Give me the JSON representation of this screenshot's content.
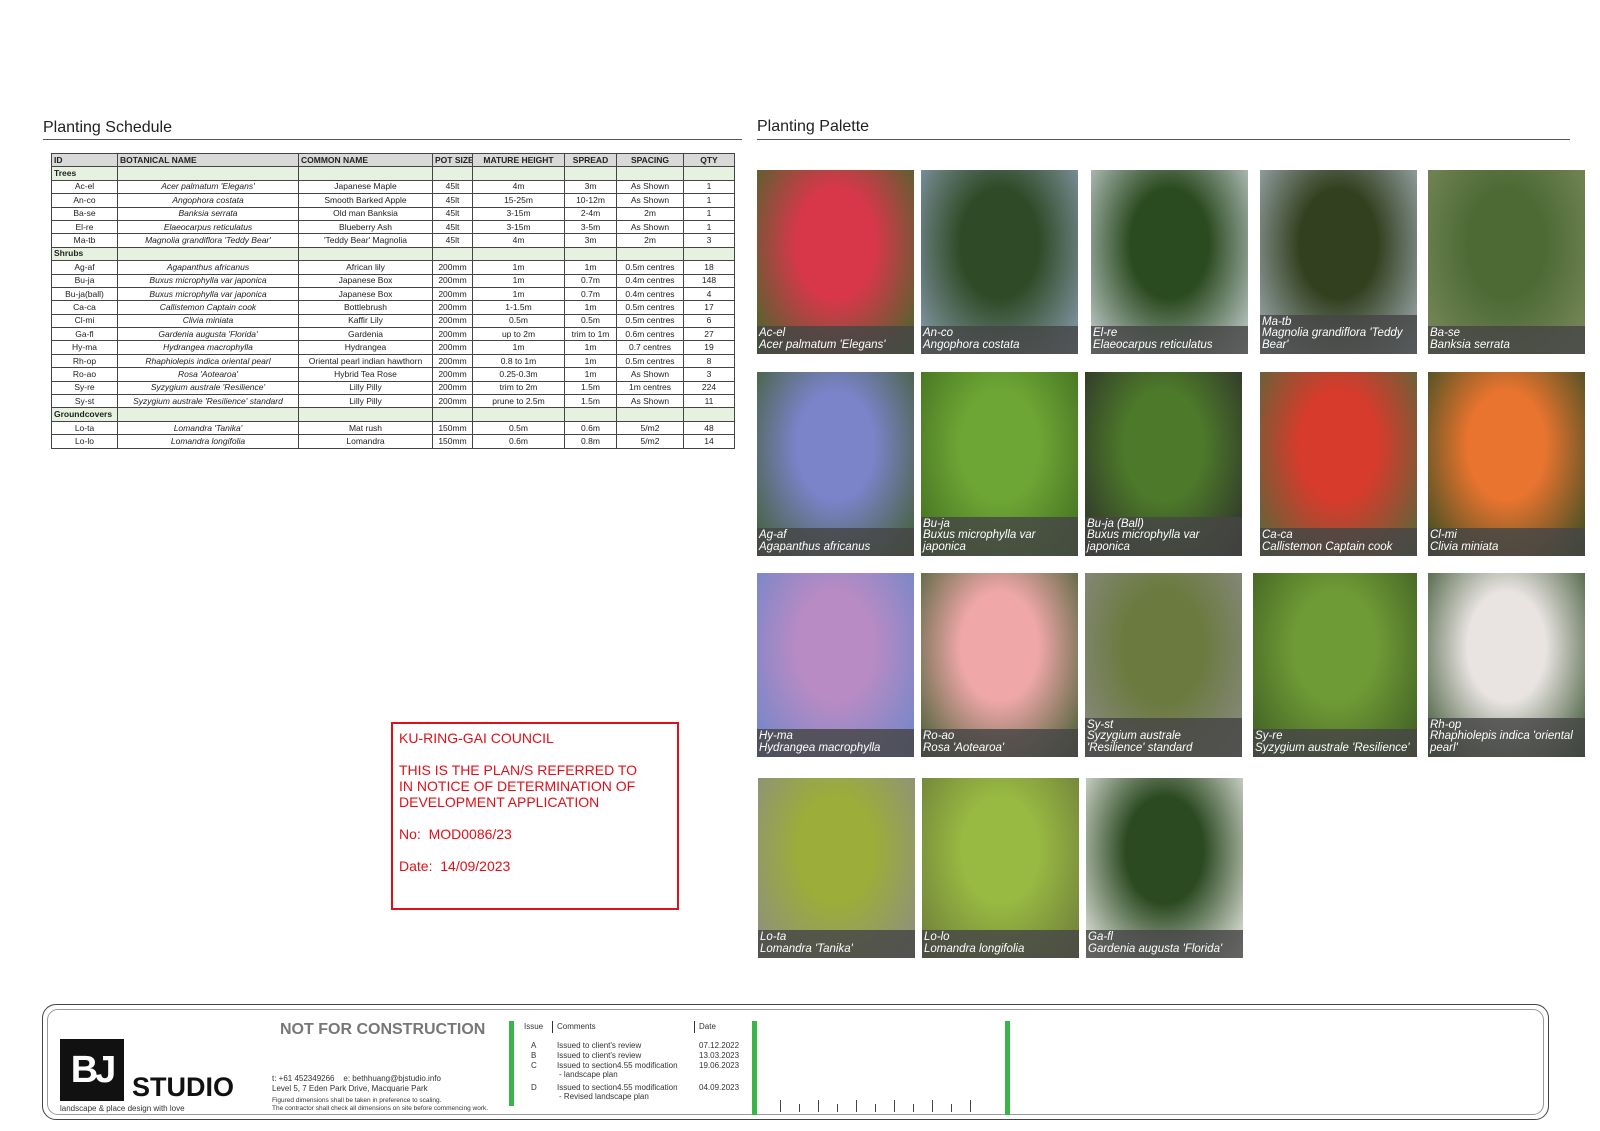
{
  "schedule": {
    "title": "Planting Schedule",
    "headers": [
      "ID",
      "BOTANICAL NAME",
      "COMMON NAME",
      "POT SIZE",
      "MATURE HEIGHT",
      "SPREAD",
      "SPACING",
      "QTY"
    ],
    "groups": [
      {
        "name": "Trees",
        "rows": [
          [
            "Ac-el",
            "Acer palmatum 'Elegans'",
            "Japanese Maple",
            "45lt",
            "4m",
            "3m",
            "As Shown",
            "1"
          ],
          [
            "An-co",
            "Angophora costata",
            "Smooth Barked Apple",
            "45lt",
            "15-25m",
            "10-12m",
            "As Shown",
            "1"
          ],
          [
            "Ba-se",
            "Banksia serrata",
            "Old man Banksia",
            "45lt",
            "3-15m",
            "2-4m",
            "2m",
            "1"
          ],
          [
            "El-re",
            "Elaeocarpus reticulatus",
            "Blueberry Ash",
            "45lt",
            "3-15m",
            "3-5m",
            "As Shown",
            "1"
          ],
          [
            "Ma-tb",
            "Magnolia grandiflora 'Teddy Bear'",
            "'Teddy Bear' Magnolia",
            "45lt",
            "4m",
            "3m",
            "2m",
            "3"
          ]
        ]
      },
      {
        "name": "Shrubs",
        "rows": [
          [
            "Ag-af",
            "Agapanthus africanus",
            "African lily",
            "200mm",
            "1m",
            "1m",
            "0.5m centres",
            "18"
          ],
          [
            "Bu-ja",
            "Buxus microphylla var japonica",
            "Japanese Box",
            "200mm",
            "1m",
            "0.7m",
            "0.4m centres",
            "148"
          ],
          [
            "Bu-ja(ball)",
            "Buxus microphylla var japonica",
            "Japanese Box",
            "200mm",
            "1m",
            "0.7m",
            "0.4m centres",
            "4"
          ],
          [
            "Ca-ca",
            "Callistemon Captain cook",
            "Bottlebrush",
            "200mm",
            "1-1.5m",
            "1m",
            "0.5m centres",
            "17"
          ],
          [
            "Cl-mi",
            "Clivia miniata",
            "Kaffir Lily",
            "200mm",
            "0.5m",
            "0.5m",
            "0.5m centres",
            "6"
          ],
          [
            "Ga-fl",
            "Gardenia augusta 'Florida'",
            "Gardenia",
            "200mm",
            "up to 2m",
            "trim to 1m",
            "0.6m centres",
            "27"
          ],
          [
            "Hy-ma",
            "Hydrangea macrophylla",
            "Hydrangea",
            "200mm",
            "1m",
            "1m",
            "0.7 centres",
            "19"
          ],
          [
            "Rh-op",
            "Rhaphiolepis indica oriental pearl",
            "Oriental pearl indian hawthorn",
            "200mm",
            "0.8 to 1m",
            "1m",
            "0.5m centres",
            "8"
          ],
          [
            "Ro-ao",
            "Rosa 'Aotearoa'",
            "Hybrid Tea Rose",
            "200mm",
            "0.25-0.3m",
            "1m",
            "As Shown",
            "3"
          ],
          [
            "Sy-re",
            "Syzygium australe 'Resilience'",
            "Lilly Pilly",
            "200mm",
            "trim to 2m",
            "1.5m",
            "1m centres",
            "224"
          ],
          [
            "Sy-st",
            "Syzygium australe 'Resilience' standard",
            "Lilly Pilly",
            "200mm",
            "prune to 2.5m",
            "1.5m",
            "As Shown",
            "11"
          ]
        ]
      },
      {
        "name": "Groundcovers",
        "rows": [
          [
            "Lo-ta",
            "Lomandra 'Tanika'",
            "Mat rush",
            "150mm",
            "0.5m",
            "0.6m",
            "5/m2",
            "48"
          ],
          [
            "Lo-lo",
            "Lomandra longifolia",
            "Lomandra",
            "150mm",
            "0.6m",
            "0.8m",
            "5/m2",
            "14"
          ]
        ]
      }
    ]
  },
  "palette": {
    "title": "Planting Palette",
    "tiles": [
      {
        "code": "Ac-el",
        "name": "Acer palmatum 'Elegans'",
        "colors": [
          "#d8374a",
          "#3c6b2a"
        ]
      },
      {
        "code": "An-co",
        "name": "Angophora costata",
        "colors": [
          "#2e4a26",
          "#8ea0b5"
        ]
      },
      {
        "code": "El-re",
        "name": "Elaeocarpus reticulatus",
        "colors": [
          "#2a4a1f",
          "#cfd7dc"
        ]
      },
      {
        "code": "Ma-tb",
        "name": "Magnolia grandiflora 'Teddy Bear'",
        "colors": [
          "#33401f",
          "#a9b7c2"
        ]
      },
      {
        "code": "Ba-se",
        "name": "Banksia serrata",
        "colors": [
          "#4d6a35",
          "#7c8b5e"
        ]
      },
      {
        "code": "Ag-af",
        "name": "Agapanthus africanus",
        "colors": [
          "#7b83c9",
          "#3e5d2c"
        ]
      },
      {
        "code": "Bu-ja",
        "name": "Buxus microphylla var japonica",
        "colors": [
          "#6ea635",
          "#3e6a1f"
        ]
      },
      {
        "code": "Bu-ja (Ball)",
        "name": "Buxus microphylla var japonica",
        "colors": [
          "#4d7a2a",
          "#2b2b2b"
        ]
      },
      {
        "code": "Ca-ca",
        "name": "Callistemon Captain cook",
        "colors": [
          "#d73b2c",
          "#4d6b3b"
        ]
      },
      {
        "code": "Cl-mi",
        "name": "Clivia miniata",
        "colors": [
          "#e8742f",
          "#2c4a22"
        ]
      },
      {
        "code": "Hy-ma",
        "name": "Hydrangea macrophylla",
        "colors": [
          "#b88bc4",
          "#6b86c9"
        ]
      },
      {
        "code": "Ro-ao",
        "name": "Rosa 'Aotearoa'",
        "colors": [
          "#efa7a8",
          "#3d5b2e"
        ]
      },
      {
        "code": "Sy-st",
        "name": "Syzygium australe 'Resilience' standard",
        "colors": [
          "#6b7a3e",
          "#8b8b88"
        ]
      },
      {
        "code": "Sy-re",
        "name": "Syzygium australe 'Resilience'",
        "colors": [
          "#6f9b36",
          "#3c5a22"
        ]
      },
      {
        "code": "Rh-op",
        "name": "Rhaphiolepis indica 'oriental pearl'",
        "colors": [
          "#e9e4e2",
          "#2f4a25"
        ]
      },
      {
        "code": "Lo-ta",
        "name": "Lomandra 'Tanika'",
        "colors": [
          "#9cad3a",
          "#8c8c86"
        ]
      },
      {
        "code": "Lo-lo",
        "name": "Lomandra longifolia",
        "colors": [
          "#98b942",
          "#6b7a3a"
        ]
      },
      {
        "code": "Ga-fl",
        "name": "Gardenia augusta 'Florida'",
        "colors": [
          "#2c4a22",
          "#f3f3ef"
        ]
      }
    ]
  },
  "stamp": {
    "council": "KU-RING-GAI COUNCIL",
    "line1": "THIS IS THE PLAN/S REFERRED TO",
    "line2": "IN NOTICE OF DETERMINATION OF",
    "line3": "DEVELOPMENT APPLICATION",
    "no_label": "No:",
    "no_value": "MOD0086/23",
    "date_label": "Date:",
    "date_value": "14/09/2023"
  },
  "titleblock": {
    "logo": "BJ",
    "studio": "STUDIO",
    "tagline": "landscape & place design with love",
    "not_for_construction": "NOT FOR CONSTRUCTION",
    "phone": "t: +61 452349266",
    "email": "e: bethhuang@bjstudio.info",
    "address": "Level 5, 7 Eden Park Drive, Macquarie Park",
    "note1": "Figured dimensions shall be taken in preference to scaling.",
    "note2": "The contractor shall check all dimensions on site before commencing work.",
    "rev_headers": {
      "issue": "Issue",
      "comments": "Comments",
      "date": "Date"
    },
    "revisions": [
      {
        "issue": "A",
        "comment": "Issued to client's review",
        "comment2": "",
        "date": "07.12.2022"
      },
      {
        "issue": "B",
        "comment": "Issued to client's review",
        "comment2": "",
        "date": "13.03.2023"
      },
      {
        "issue": "C",
        "comment": "Issued to section4.55 modification",
        "comment2": "- landscape plan",
        "date": "19.06.2023"
      },
      {
        "issue": "D",
        "comment": "Issued to section4.55 modification",
        "comment2": "- Revised landscape plan",
        "date": "04.09.2023"
      }
    ],
    "accent_color": "#3ab54a"
  }
}
